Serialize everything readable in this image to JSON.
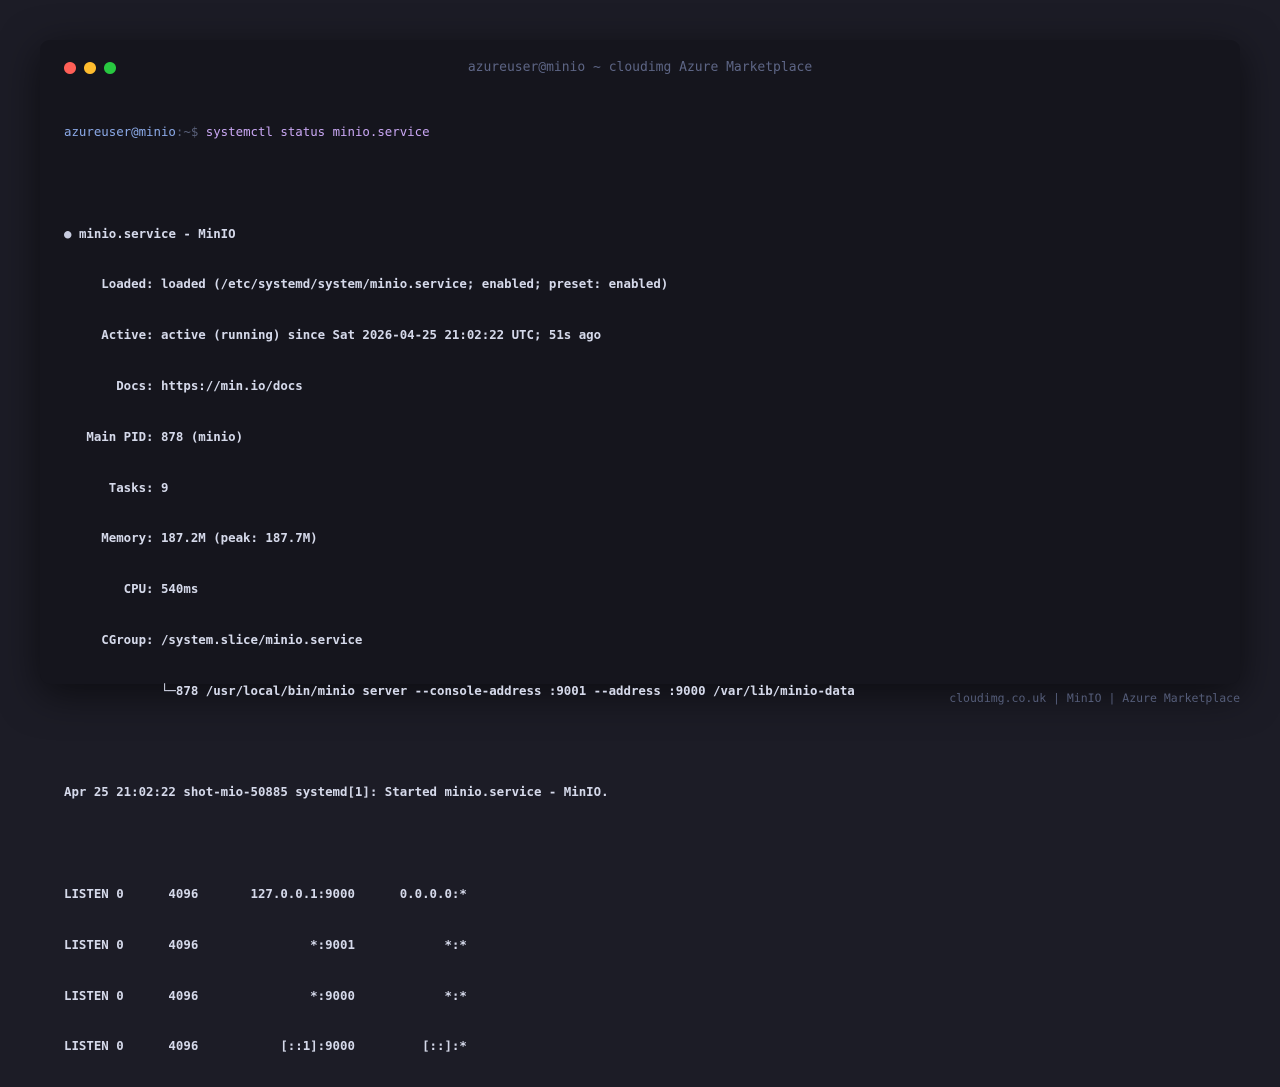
{
  "window": {
    "title": "azureuser@minio ~ cloudimg Azure Marketplace",
    "traffic_lights": [
      "#ff5f57",
      "#febc2e",
      "#28c840"
    ]
  },
  "prompt": {
    "user_host": "azureuser@minio",
    "path_symbol": ":~$",
    "command": "systemctl status minio.service"
  },
  "status": {
    "bullet": "●",
    "header": "minio.service - MinIO",
    "loaded": "     Loaded: loaded (/etc/systemd/system/minio.service; enabled; preset: enabled)",
    "active": "     Active: active (running) since Sat 2026-04-25 21:02:22 UTC; 51s ago",
    "docs": "       Docs: https://min.io/docs",
    "main_pid": "   Main PID: 878 (minio)",
    "tasks": "      Tasks: 9",
    "memory": "     Memory: 187.2M (peak: 187.7M)",
    "cpu": "        CPU: 540ms",
    "cgroup": "     CGroup: /system.slice/minio.service",
    "process": "             └─878 /usr/local/bin/minio server --console-address :9001 --address :9000 /var/lib/minio-data"
  },
  "journal_line": "Apr 25 21:02:22 shot-mio-50885 systemd[1]: Started minio.service - MinIO.",
  "listen_lines": [
    "LISTEN 0      4096       127.0.0.1:9000      0.0.0.0:*",
    "LISTEN 0      4096               *:9001            *:*",
    "LISTEN 0      4096               *:9000            *:*",
    "LISTEN 0      4096           [::1]:9000         [::]:*"
  ],
  "footer": "cloudimg.co.uk | MinIO | Azure Marketplace"
}
